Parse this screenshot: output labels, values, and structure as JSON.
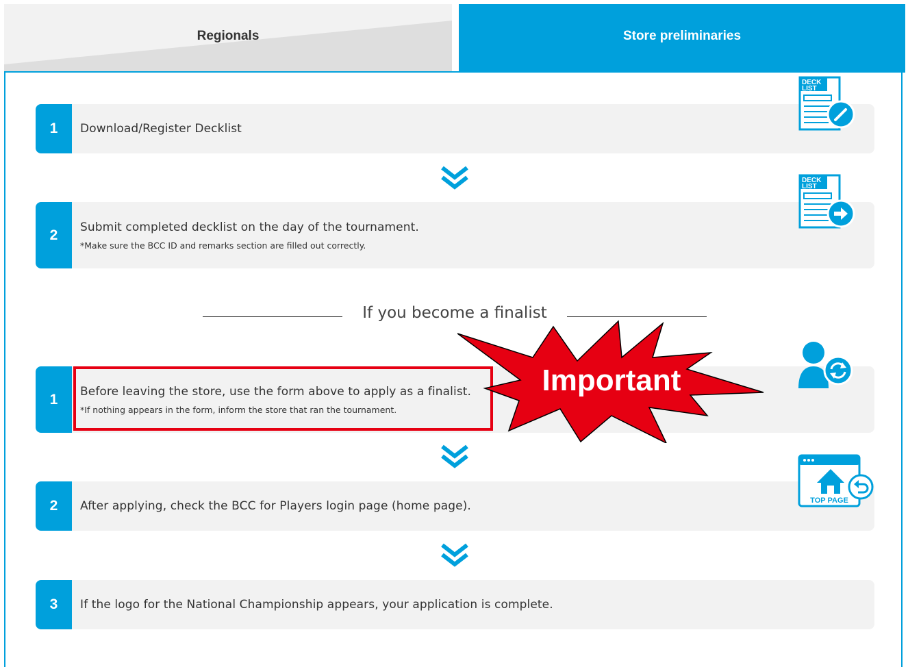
{
  "tabs": [
    {
      "label": "Regionals",
      "active": false
    },
    {
      "label": "Store preliminaries",
      "active": true
    }
  ],
  "colors": {
    "accent": "#00a0dc",
    "alert": "#e60012",
    "step_bg": "#f2f2f2"
  },
  "steps_before": [
    {
      "number": "1",
      "text": "Download/Register Decklist",
      "note": "",
      "icon": "decklist-edit-icon"
    },
    {
      "number": "2",
      "text": "Submit completed decklist on the day of the tournament.",
      "note": "*Make sure the BCC ID and remarks section are filled out correctly.",
      "icon": "decklist-submit-icon"
    }
  ],
  "divider_label": "If you become a finalist",
  "steps_after": [
    {
      "number": "1",
      "text": "Before leaving the store, use the form above to apply as a finalist.",
      "note": "*If nothing appears in the form, inform the store that ran the tournament.",
      "icon": "user-sync-icon"
    },
    {
      "number": "2",
      "text": "After applying, check the BCC for Players login page (home page).",
      "note": "",
      "icon": "top-page-icon"
    },
    {
      "number": "3",
      "text": "If the logo for the National Championship appears, your application is complete.",
      "note": "",
      "icon": ""
    }
  ],
  "icon_text": {
    "deck_top": "DECK",
    "deck_bottom": "LIST",
    "top_page": "TOP PAGE"
  },
  "important_label": "Important"
}
